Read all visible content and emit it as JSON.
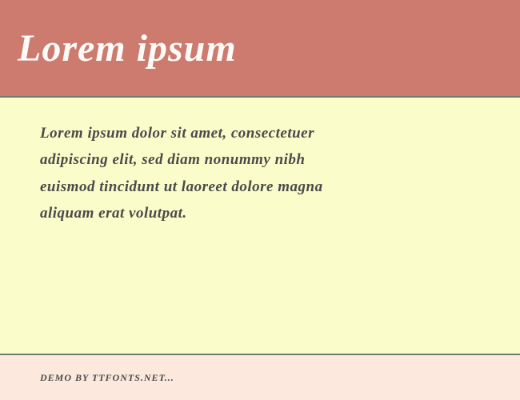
{
  "header": {
    "title": "Lorem ipsum"
  },
  "content": {
    "body_text": "Lorem ipsum dolor sit amet, consectetuer adipiscing elit, sed diam nonummy nibh euismod tincidunt ut laoreet dolore magna aliquam erat volutpat."
  },
  "footer": {
    "credit": "DEMO BY TTFONTS.NET..."
  },
  "colors": {
    "header_bg": "#cd7a6f",
    "content_bg": "#fafcc9",
    "footer_bg": "#fce8dc",
    "divider": "#6b7d6f",
    "title_color": "#fdfbf7",
    "text_color": "#4a4a4a"
  }
}
